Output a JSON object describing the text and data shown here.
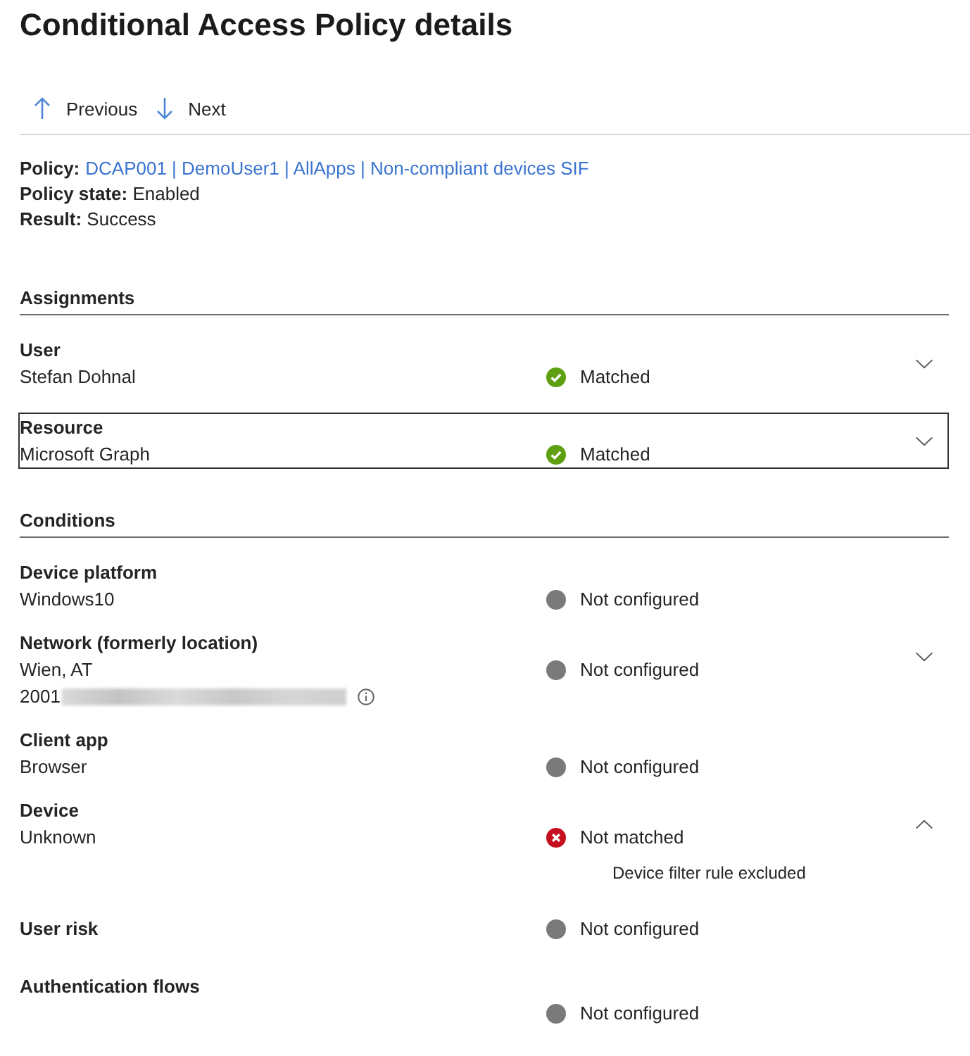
{
  "page": {
    "title": "Conditional Access Policy details"
  },
  "toolbar": [
    {
      "kind": "up",
      "label": "Previous"
    },
    {
      "kind": "down",
      "label": "Next"
    }
  ],
  "summary": {
    "policy": {
      "label": "Policy:",
      "link": "DCAP001 | DemoUser1 | AllApps | Non-compliant devices SIF"
    },
    "lines": [
      "**Policy state:** Enabled",
      "**Result:** Success"
    ]
  },
  "sections": [
    {
      "title": "Assignments",
      "rows": [
        {
          "label": "User",
          "kind": "stacked",
          "focused": false,
          "expanded": false,
          "values": [
            {
              "text": "Stefan Dohnal"
            }
          ],
          "status": {
            "kind": "matched",
            "text": "Matched"
          }
        },
        {
          "label": "Resource",
          "kind": "stacked",
          "focused": true,
          "expanded": false,
          "values": [
            {
              "text": "Microsoft Graph"
            }
          ],
          "status": {
            "kind": "matched",
            "text": "Matched"
          }
        }
      ]
    },
    {
      "title": "Conditions",
      "rows": [
        {
          "label": "Device platform",
          "kind": "stacked",
          "focused": false,
          "values": [
            {
              "text": "Windows10"
            }
          ],
          "status": {
            "kind": "not_configured",
            "text": "Not configured"
          }
        },
        {
          "label": "Network (formerly location)",
          "kind": "stacked",
          "focused": false,
          "expanded": false,
          "values": [
            {
              "text": "Wien, AT"
            },
            {
              "text": "2001",
              "redacted": true,
              "info": true
            }
          ],
          "status": {
            "kind": "not_configured",
            "text": "Not configured"
          }
        },
        {
          "label": "Client app",
          "kind": "stacked",
          "focused": false,
          "values": [
            {
              "text": "Browser"
            }
          ],
          "status": {
            "kind": "not_configured",
            "text": "Not configured"
          }
        },
        {
          "label": "Device",
          "kind": "stacked",
          "focused": false,
          "expanded": true,
          "values": [
            {
              "text": "Unknown"
            }
          ],
          "status": {
            "kind": "not_matched",
            "text": "Not matched",
            "detail": "Device filter rule excluded"
          }
        },
        {
          "label": "User risk",
          "kind": "inline",
          "focused": false,
          "values": [],
          "status": {
            "kind": "not_configured",
            "text": "Not configured"
          }
        },
        {
          "label": "Authentication flows",
          "kind": "stacked",
          "focused": false,
          "values": [],
          "status": {
            "kind": "not_configured",
            "text": "Not configured"
          }
        }
      ]
    }
  ]
}
